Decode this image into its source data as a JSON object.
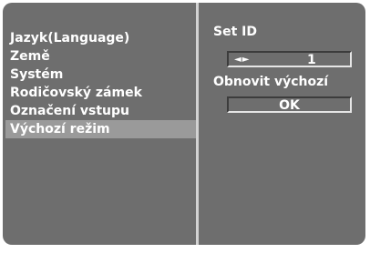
{
  "menu": {
    "items": [
      {
        "label": "Jazyk(Language)",
        "selected": false
      },
      {
        "label": "Země",
        "selected": false
      },
      {
        "label": "Systém",
        "selected": false
      },
      {
        "label": "Rodičovský zámek",
        "selected": false
      },
      {
        "label": "Označení vstupu",
        "selected": false
      },
      {
        "label": "Výchozí režim",
        "selected": true
      }
    ]
  },
  "settings": {
    "set_id_label": "Set ID",
    "set_id_arrows": "◄►",
    "set_id_value": "1",
    "reset_label": "Obnovit výchozí",
    "ok_label": "OK"
  },
  "colors": {
    "background": "#6e6e6e",
    "selected_row": "#9a9a9a",
    "divider": "#d2d2d2",
    "text": "#ffffff"
  }
}
